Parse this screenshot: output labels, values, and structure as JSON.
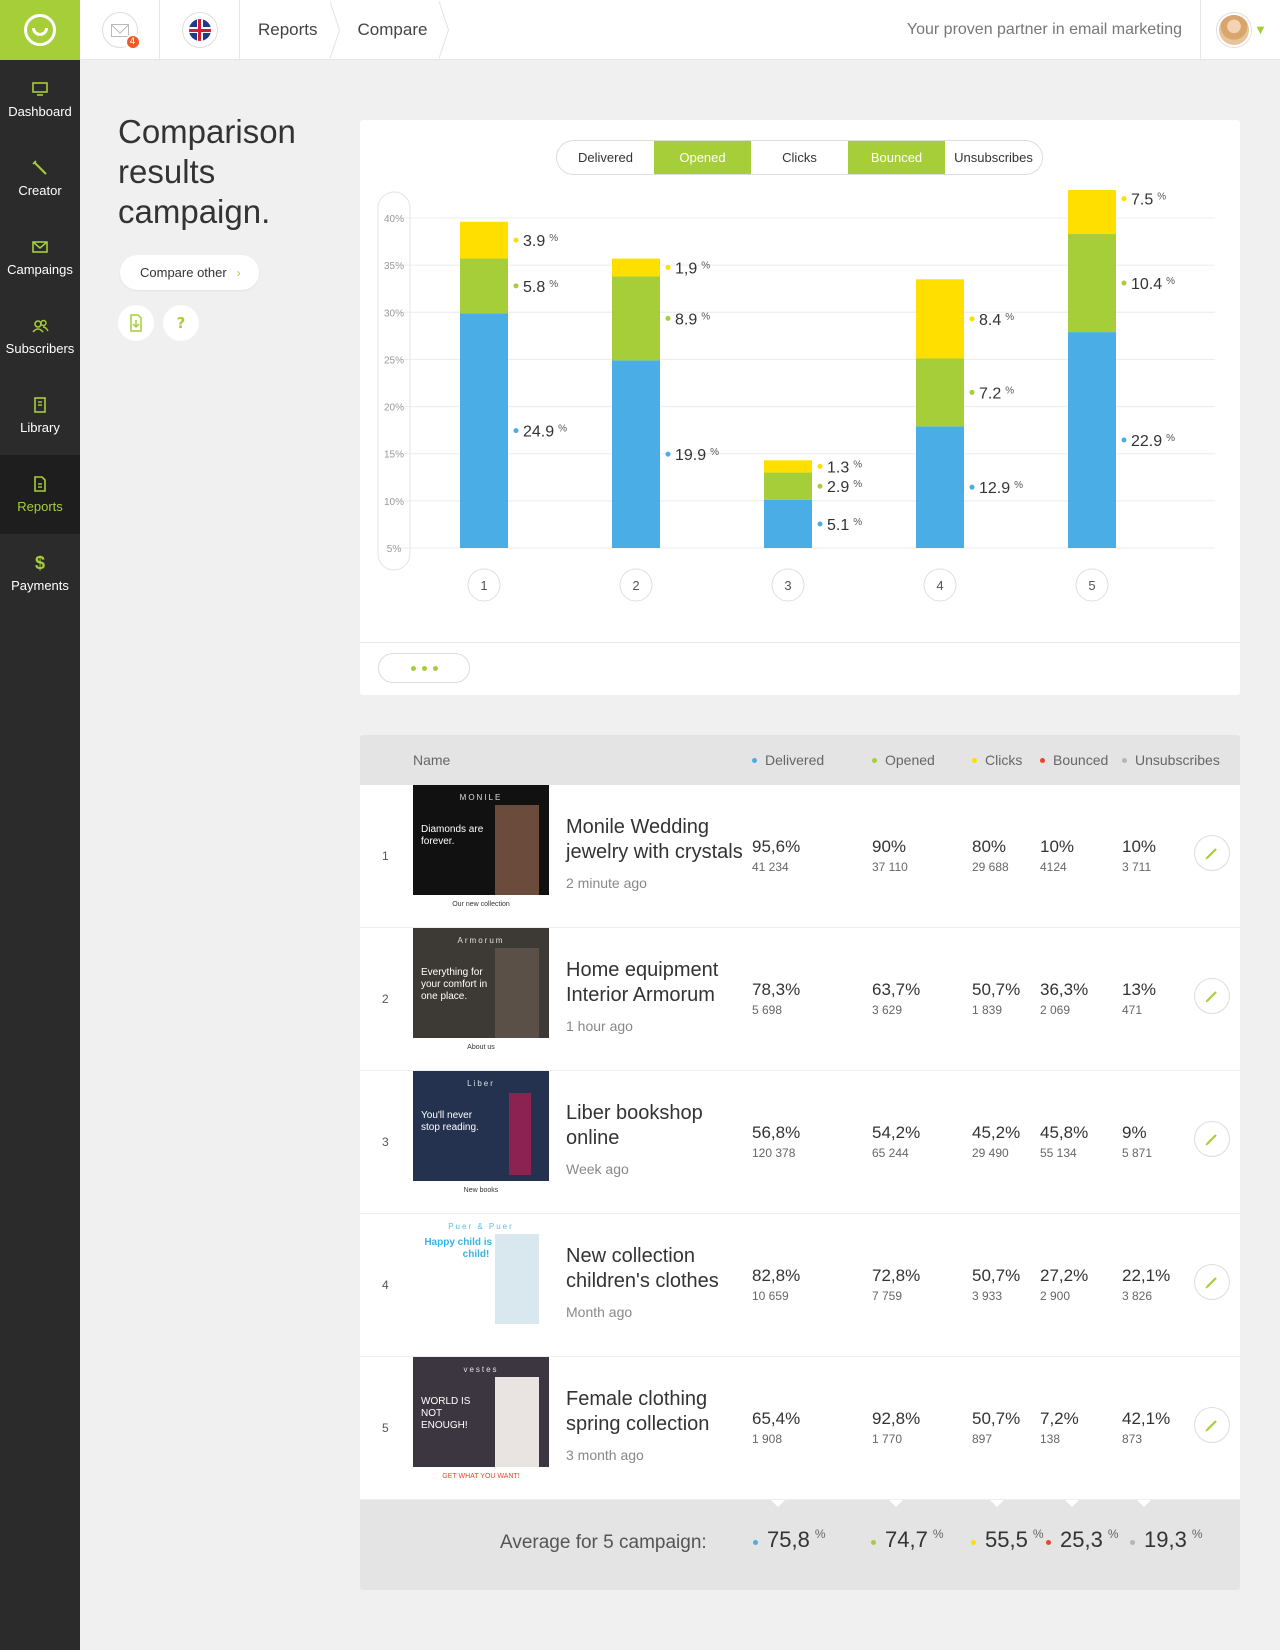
{
  "header": {
    "mail_badge": "4",
    "breadcrumbs": [
      "Reports",
      "Compare"
    ],
    "tagline": "Your proven partner in email marketing"
  },
  "sidebar": {
    "items": [
      {
        "label": "Dashboard",
        "icon": "monitor-icon",
        "active": false
      },
      {
        "label": "Creator",
        "icon": "pencil-icon",
        "active": false
      },
      {
        "label": "Campaings",
        "icon": "envelope-icon",
        "active": false
      },
      {
        "label": "Subscribers",
        "icon": "users-icon",
        "active": false
      },
      {
        "label": "Library",
        "icon": "book-icon",
        "active": false
      },
      {
        "label": "Reports",
        "icon": "report-icon",
        "active": true
      },
      {
        "label": "Payments",
        "icon": "dollar-icon",
        "active": false
      }
    ]
  },
  "page": {
    "title_lines": [
      "Comparison",
      "results",
      "campaign."
    ],
    "compare_other": "Compare other",
    "question": "?"
  },
  "filters": [
    {
      "label": "Delivered",
      "active": false
    },
    {
      "label": "Opened",
      "active": true
    },
    {
      "label": "Clicks",
      "active": false
    },
    {
      "label": "Bounced",
      "active": true
    },
    {
      "label": "Unsubscribes",
      "active": false
    }
  ],
  "colors": {
    "accent": "#a6ce39",
    "blue": "#4aade5",
    "green": "#a6ce39",
    "yellow": "#ffdf00",
    "red": "#e8462f",
    "grey": "#b5b5b5",
    "sidebar": "#2b2b2b"
  },
  "chart_data": {
    "type": "bar",
    "stacked": true,
    "categories": [
      "1",
      "2",
      "3",
      "4",
      "5"
    ],
    "y_ticks": [
      "40%",
      "35%",
      "30%",
      "25%",
      "20%",
      "15%",
      "10%",
      "5%"
    ],
    "ylim": [
      5,
      40
    ],
    "grid": true,
    "series": [
      {
        "color": "#4aade5",
        "values": [
          24.9,
          19.9,
          5.1,
          12.9,
          22.9
        ]
      },
      {
        "color": "#a6ce39",
        "values": [
          5.8,
          8.9,
          2.9,
          7.2,
          10.4
        ]
      },
      {
        "color": "#ffdf00",
        "values": [
          3.9,
          1.9,
          1.3,
          8.4,
          7.5
        ]
      }
    ],
    "value_labels": [
      [
        "24.9",
        "5.8",
        "3.9"
      ],
      [
        "19.9",
        "8.9",
        "1,9"
      ],
      [
        "5.1",
        "2.9",
        "1.3"
      ],
      [
        "12.9",
        "7.2",
        "8.4"
      ],
      [
        "22.9",
        "10.4",
        "7.5"
      ]
    ],
    "unit": "%"
  },
  "table": {
    "headers": {
      "name": "Name",
      "delivered": "Delivered",
      "opened": "Opened",
      "clicks": "Clicks",
      "bounced": "Bounced",
      "unsubscribes": "Unsubscribes"
    },
    "rows": [
      {
        "index": "1",
        "name": "Monile Wedding jewelry with crystals",
        "time": "2 minute ago",
        "thumb": {
          "brand": "MONILE",
          "headline": "Diamonds are forever.",
          "caption": "Our new collection"
        },
        "metrics": [
          {
            "pct": "95,6%",
            "count": "41 234"
          },
          {
            "pct": "90%",
            "count": "37 110"
          },
          {
            "pct": "80%",
            "count": "29 688"
          },
          {
            "pct": "10%",
            "count": "4124"
          },
          {
            "pct": "10%",
            "count": "3 711"
          }
        ]
      },
      {
        "index": "2",
        "name": "Home equipment Interior Armorum",
        "time": "1 hour ago",
        "thumb": {
          "brand": "Armorum",
          "headline": "Everything for your comfort in one place.",
          "caption": "About us"
        },
        "metrics": [
          {
            "pct": "78,3%",
            "count": "5 698"
          },
          {
            "pct": "63,7%",
            "count": "3 629"
          },
          {
            "pct": "50,7%",
            "count": "1 839"
          },
          {
            "pct": "36,3%",
            "count": "2 069"
          },
          {
            "pct": "13%",
            "count": "471"
          }
        ]
      },
      {
        "index": "3",
        "name": "Liber bookshop online",
        "time": "Week ago",
        "thumb": {
          "brand": "Liber",
          "headline": "You'll never stop reading.",
          "caption": "New books"
        },
        "metrics": [
          {
            "pct": "56,8%",
            "count": "120 378"
          },
          {
            "pct": "54,2%",
            "count": "65 244"
          },
          {
            "pct": "45,2%",
            "count": "29 490"
          },
          {
            "pct": "45,8%",
            "count": "55 134"
          },
          {
            "pct": "9%",
            "count": "5 871"
          }
        ]
      },
      {
        "index": "4",
        "name": "New collection children's clothes",
        "time": "Month ago",
        "thumb": {
          "brand": "Puer & Puer",
          "headline": "Happy child is a good child!",
          "caption": ""
        },
        "metrics": [
          {
            "pct": "82,8%",
            "count": "10 659"
          },
          {
            "pct": "72,8%",
            "count": "7 759"
          },
          {
            "pct": "50,7%",
            "count": "3 933"
          },
          {
            "pct": "27,2%",
            "count": "2 900"
          },
          {
            "pct": "22,1%",
            "count": "3 826"
          }
        ]
      },
      {
        "index": "5",
        "name": "Female clothing spring collection",
        "time": "3 month ago",
        "thumb": {
          "brand": "vestes",
          "headline": "WORLD IS NOT ENOUGH!",
          "caption": "GET WHAT YOU WANT!"
        },
        "metrics": [
          {
            "pct": "65,4%",
            "count": "1 908"
          },
          {
            "pct": "92,8%",
            "count": "1 770"
          },
          {
            "pct": "50,7%",
            "count": "897"
          },
          {
            "pct": "7,2%",
            "count": "138"
          },
          {
            "pct": "42,1%",
            "count": "873"
          }
        ]
      }
    ],
    "average": {
      "label": "Average for 5 campaign:",
      "unit": "%",
      "values": [
        "75,8",
        "74,7",
        "55,5",
        "25,3",
        "19,3"
      ]
    }
  }
}
